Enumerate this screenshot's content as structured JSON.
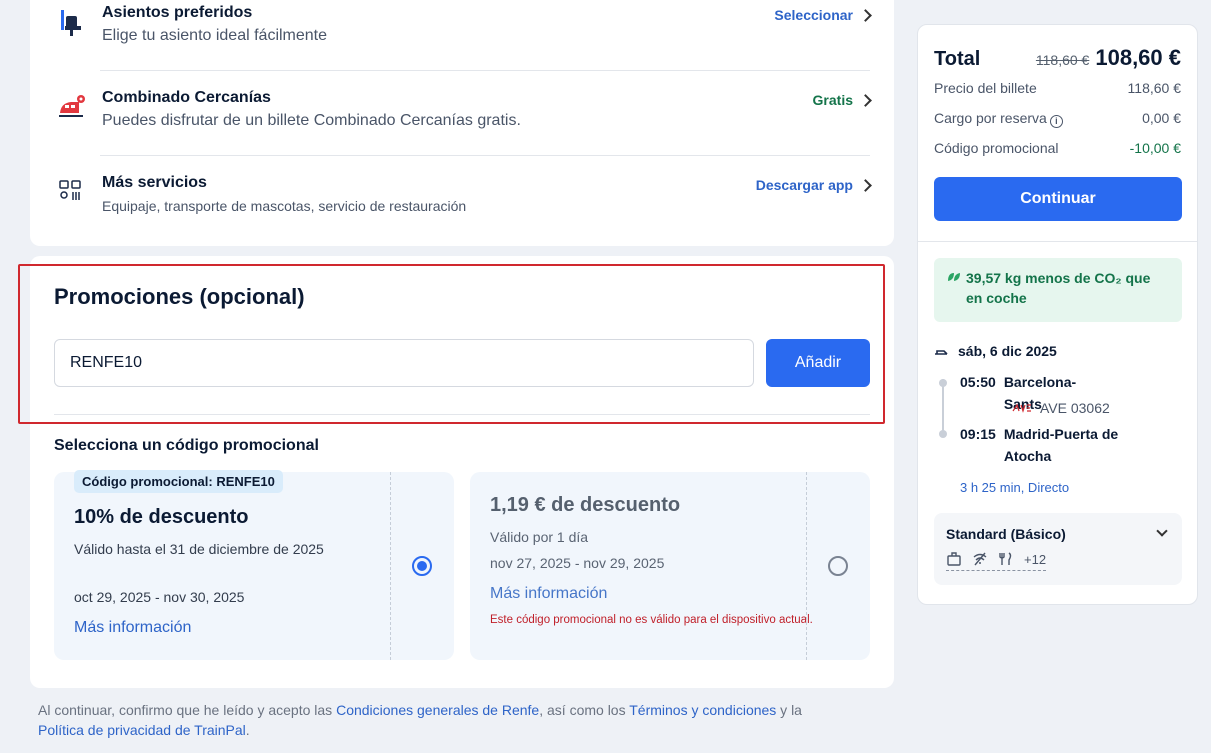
{
  "services": [
    {
      "title": "Asientos preferidos",
      "subtitle": "Elige tu asiento ideal fácilmente",
      "link": "Seleccionar",
      "link_color": "#2e64c8",
      "icon": "seat-icon"
    },
    {
      "title": "Combinado Cercanías",
      "subtitle": "Puedes disfrutar de un billete Combinado Cercanías gratis.",
      "link": "Gratis",
      "link_color": "#14744a",
      "icon": "train-icon"
    },
    {
      "title": "Más servicios",
      "subtitle": "Equipaje, transporte de mascotas, servicio de restauración",
      "link": "Descargar app",
      "link_color": "#2e64c8",
      "icon": "services-icon"
    }
  ],
  "promotions": {
    "title": "Promociones (opcional)",
    "code_value": "RENFE10",
    "add_label": "Añadir",
    "select_title": "Selecciona un código promocional",
    "coupons": [
      {
        "tag": "Código promocional: RENFE10",
        "title": "10% de descuento",
        "validity": "Válido hasta el 31 de diciembre de 2025",
        "dates": "oct 29, 2025 - nov 30, 2025",
        "more": "Más información",
        "selected": true
      },
      {
        "title": "1,19 € de descuento",
        "validity": "Válido por 1 día",
        "dates": "nov 27, 2025 - nov 29, 2025",
        "more": "Más información",
        "error": "Este código promocional no es válido para el dispositivo actual.",
        "selected": false
      }
    ]
  },
  "legal": {
    "part1": "Al continuar, confirmo que he leído y acepto las ",
    "link1": "Condiciones generales de Renfe",
    "part2": ", así como los ",
    "link2": "Términos y condiciones",
    "part3": " y la ",
    "link3": "Política de privacidad de TrainPal",
    "part4": "."
  },
  "summary": {
    "total_label": "Total",
    "total_old": "118,60 €",
    "total_new": "108,60 €",
    "rows": [
      {
        "label": "Precio del billete",
        "value": "118,60 €"
      },
      {
        "label": "Cargo por reserva",
        "value": "0,00 €",
        "info": true
      },
      {
        "label": "Código promocional",
        "value": "-10,00 €",
        "green": true
      }
    ],
    "continue_label": "Continuar",
    "co2_text": "39,57 kg menos de CO₂ que en coche",
    "date": "sáb, 6 dic 2025",
    "depart_time": "05:50",
    "depart_station": "Barcelona-Sants",
    "train": "AVE 03062",
    "arrive_time": "09:15",
    "arrive_station": "Madrid-Puerta de Atocha",
    "duration": "3 h 25 min, Directo",
    "fare": "Standard (Básico)",
    "amenities_more": "+12"
  }
}
